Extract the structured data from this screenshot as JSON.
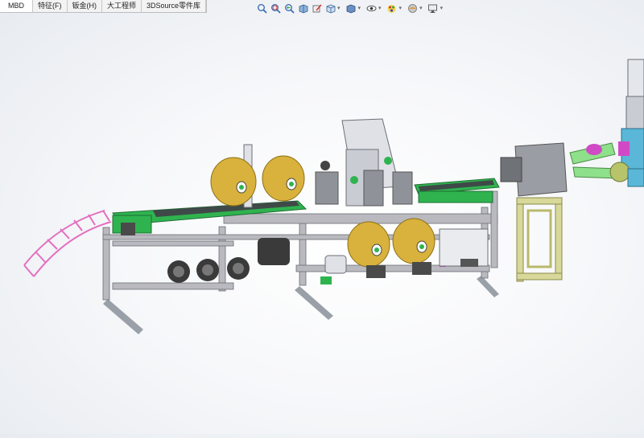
{
  "tabs": [
    {
      "label": "MBD"
    },
    {
      "label": "特征(F)"
    },
    {
      "label": "钣金(H)"
    },
    {
      "label": "大工程师"
    },
    {
      "label": "3DSource零件库"
    }
  ],
  "heads_up_toolbar": [
    {
      "icon": "zoom-to-fit-icon"
    },
    {
      "icon": "zoom-to-area-icon"
    },
    {
      "icon": "previous-view-icon"
    },
    {
      "icon": "section-view-icon"
    },
    {
      "icon": "dynamic-annotation-icon"
    },
    {
      "icon": "view-orientation-icon",
      "dropdown": true
    },
    {
      "icon": "display-style-icon",
      "dropdown": true
    },
    {
      "icon": "hide-show-items-icon",
      "dropdown": true
    },
    {
      "icon": "edit-appearance-icon",
      "dropdown": true
    },
    {
      "icon": "apply-scene-icon",
      "dropdown": true
    },
    {
      "icon": "view-settings-icon",
      "dropdown": true
    }
  ],
  "colors": {
    "frame": "#b9b9bf",
    "roll": "#d8b23c",
    "conveyor_green": "#2fb34f",
    "conveyor_belt": "#3f4a48",
    "motor": "#3a3a3a",
    "chute": "#e36fc0",
    "support_frame": "#d8d89a",
    "robot_cyan": "#5ab7d8",
    "robot_magenta": "#d04ac6",
    "robot_green": "#8fe08a"
  }
}
